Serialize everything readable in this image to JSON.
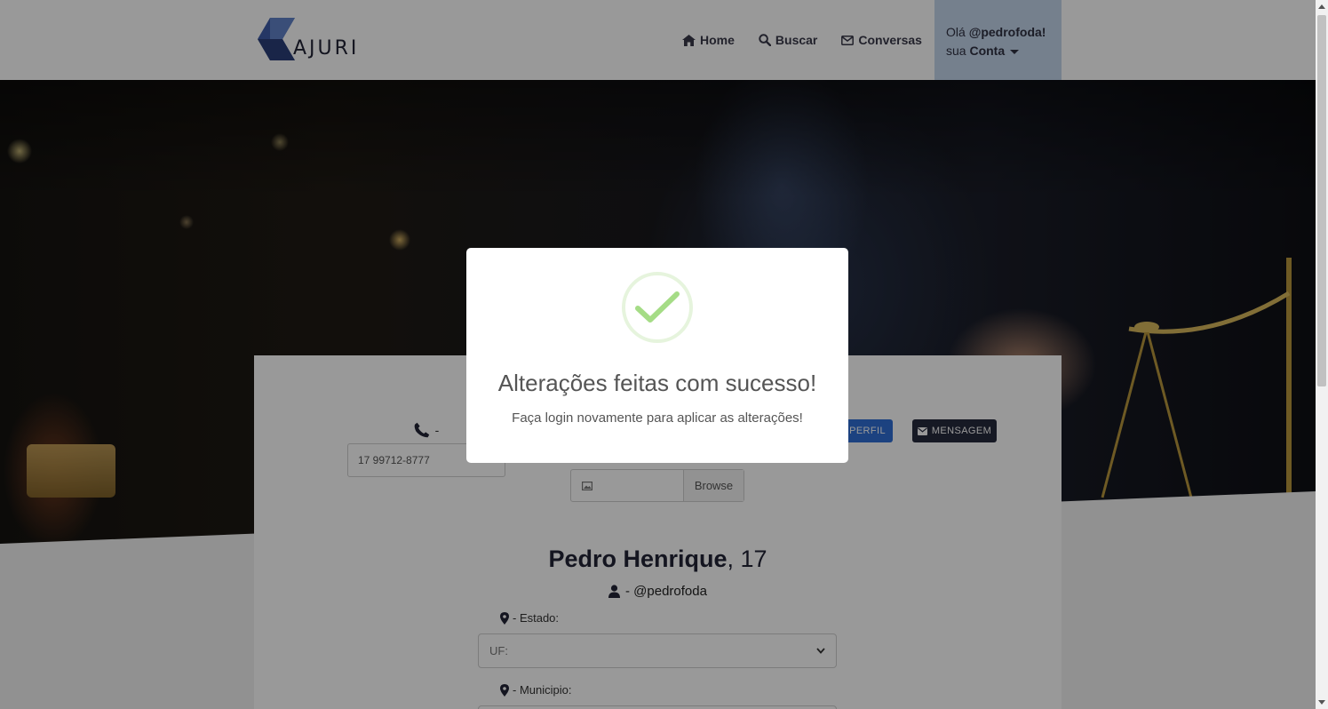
{
  "brand": {
    "name": "AJURI"
  },
  "nav": {
    "items": [
      {
        "label": "Home",
        "icon": "home-icon"
      },
      {
        "label": "Buscar",
        "icon": "search-icon"
      },
      {
        "label": "Conversas",
        "icon": "envelope-icon"
      }
    ],
    "account": {
      "greeting_prefix": "Olá ",
      "username": "@pedrofoda!",
      "line2_prefix": "sua ",
      "line2_bold": "Conta"
    }
  },
  "profile": {
    "phone_suffix": "-",
    "phone_value": "17 99712-8777",
    "edit_button_label": "R PERFIL",
    "message_button_label": "MENSAGEM",
    "browse_label": "Browse",
    "name": "Pedro Henrique",
    "age_suffix": ", 17",
    "user_line": "- @pedrofoda",
    "estado_label": "- Estado:",
    "estado_select": "UF:",
    "municipio_label": "- Municipio:"
  },
  "modal": {
    "title": "Alterações feitas com sucesso!",
    "text": "Faça login novamente para aplicar as alterações!"
  },
  "colors": {
    "brand_dark": "#222436",
    "brand_blue": "#2f6fd6",
    "account_bg": "#c4d5ec",
    "success_green": "#a5dc86"
  }
}
